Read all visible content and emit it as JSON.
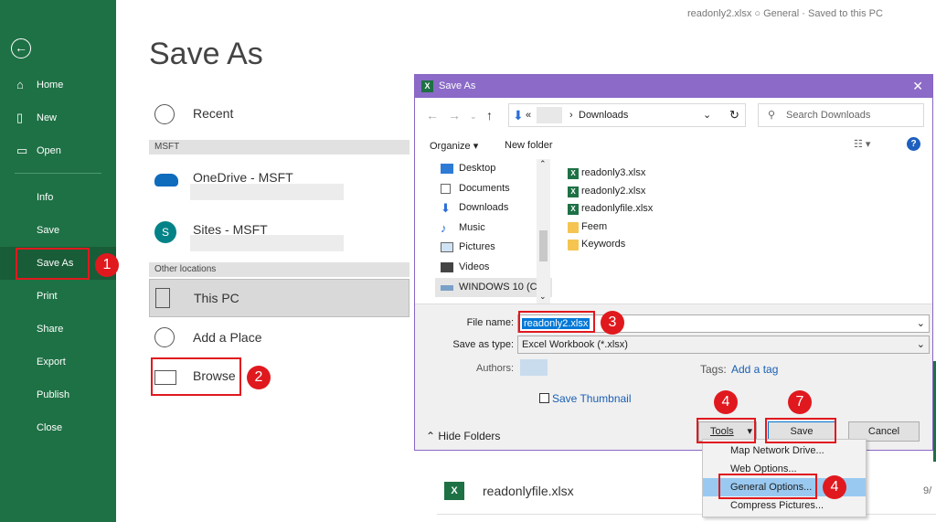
{
  "status_bar": {
    "text": "readonly2.xlsx  ○  General · Saved to this PC"
  },
  "sidebar": {
    "back_icon": "back-arrow-icon",
    "items": [
      {
        "label": "Home",
        "icon": "home-icon"
      },
      {
        "label": "New",
        "icon": "new-doc-icon"
      },
      {
        "label": "Open",
        "icon": "folder-open-icon"
      },
      {
        "label": "Info"
      },
      {
        "label": "Save"
      },
      {
        "label": "Save As"
      },
      {
        "label": "Print"
      },
      {
        "label": "Share"
      },
      {
        "label": "Export"
      },
      {
        "label": "Publish"
      },
      {
        "label": "Close"
      }
    ]
  },
  "main": {
    "title": "Save As",
    "recent": "Recent",
    "section_msft": "MSFT",
    "onedrive": "OneDrive - MSFT",
    "sites": "Sites - MSFT",
    "section_other": "Other locations",
    "this_pc": "This PC",
    "add_place": "Add a Place",
    "browse": "Browse",
    "behind_file": "readonlyfile.xlsx",
    "behind_date": "9/"
  },
  "dialog": {
    "title": "Save As",
    "address": "Downloads",
    "address_prefix": "«",
    "search_placeholder": "Search Downloads",
    "organize": "Organize ▾",
    "new_folder": "New folder",
    "tree": [
      "Desktop",
      "Documents",
      "Downloads",
      "Music",
      "Pictures",
      "Videos",
      "WINDOWS 10 (C:)"
    ],
    "files": [
      {
        "name": "readonly3.xlsx",
        "type": "excel"
      },
      {
        "name": "readonly2.xlsx",
        "type": "excel"
      },
      {
        "name": "readonlyfile.xlsx",
        "type": "excel"
      },
      {
        "name": "Feem",
        "type": "folder"
      },
      {
        "name": "Keywords",
        "type": "folder"
      }
    ],
    "file_name_label": "File name:",
    "file_name_value": "readonly2.xlsx",
    "save_type_label": "Save as type:",
    "save_type_value": "Excel Workbook (*.xlsx)",
    "authors_label": "Authors:",
    "tags_label": "Tags:",
    "tags_value": "Add a tag",
    "thumbnail_label": "Save Thumbnail",
    "hide_folders": "Hide Folders",
    "tools": "Tools",
    "save": "Save",
    "cancel": "Cancel"
  },
  "tools_menu": [
    "Map Network Drive...",
    "Web Options...",
    "General Options...",
    "Compress Pictures..."
  ],
  "badges": [
    "1",
    "2",
    "3",
    "4",
    "7",
    "4"
  ],
  "colors": {
    "excel_green": "#1e7145",
    "dialog_purple": "#8b6ac8",
    "highlight_red": "#e0191e",
    "menu_select": "#99c9f0"
  }
}
